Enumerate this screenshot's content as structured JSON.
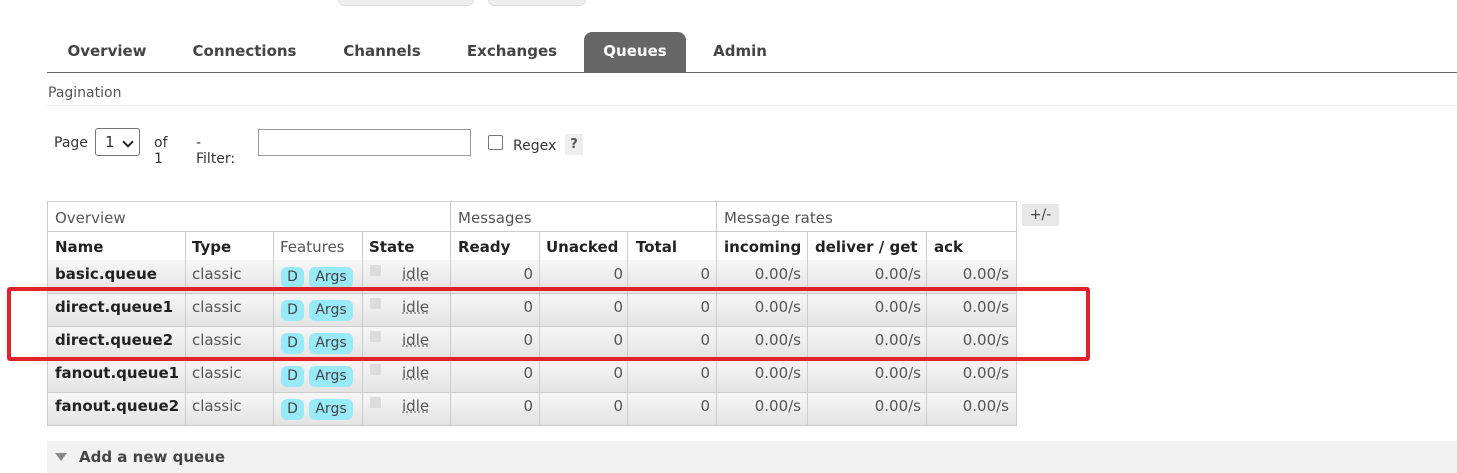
{
  "nav": {
    "tabs": [
      {
        "label": "Overview"
      },
      {
        "label": "Connections"
      },
      {
        "label": "Channels"
      },
      {
        "label": "Exchanges"
      },
      {
        "label": "Queues",
        "active": true
      },
      {
        "label": "Admin"
      }
    ]
  },
  "pagination": {
    "title": "Pagination",
    "page_label": "Page",
    "page_value": "1",
    "of_label": "of 1",
    "filter_label": "- Filter:",
    "filter_value": "",
    "regex_label": "Regex",
    "help_label": "?"
  },
  "table": {
    "groups": [
      "Overview",
      "Messages",
      "Message rates"
    ],
    "columns": [
      "Name",
      "Type",
      "Features",
      "State",
      "Ready",
      "Unacked",
      "Total",
      "incoming",
      "deliver / get",
      "ack"
    ],
    "toggle_label": "+/-",
    "rows": [
      {
        "name": "basic.queue",
        "type": "classic",
        "feature_d": "D",
        "feature_args": "Args",
        "state": "idle",
        "ready": "0",
        "unacked": "0",
        "total": "0",
        "incoming": "0.00/s",
        "deliver_get": "0.00/s",
        "ack": "0.00/s"
      },
      {
        "name": "direct.queue1",
        "type": "classic",
        "feature_d": "D",
        "feature_args": "Args",
        "state": "idle",
        "ready": "0",
        "unacked": "0",
        "total": "0",
        "incoming": "0.00/s",
        "deliver_get": "0.00/s",
        "ack": "0.00/s"
      },
      {
        "name": "direct.queue2",
        "type": "classic",
        "feature_d": "D",
        "feature_args": "Args",
        "state": "idle",
        "ready": "0",
        "unacked": "0",
        "total": "0",
        "incoming": "0.00/s",
        "deliver_get": "0.00/s",
        "ack": "0.00/s"
      },
      {
        "name": "fanout.queue1",
        "type": "classic",
        "feature_d": "D",
        "feature_args": "Args",
        "state": "idle",
        "ready": "0",
        "unacked": "0",
        "total": "0",
        "incoming": "0.00/s",
        "deliver_get": "0.00/s",
        "ack": "0.00/s"
      },
      {
        "name": "fanout.queue2",
        "type": "classic",
        "feature_d": "D",
        "feature_args": "Args",
        "state": "idle",
        "ready": "0",
        "unacked": "0",
        "total": "0",
        "incoming": "0.00/s",
        "deliver_get": "0.00/s",
        "ack": "0.00/s"
      }
    ]
  },
  "add_queue": {
    "label": "Add a new queue",
    "icon": "triangle-down-icon"
  },
  "colors": {
    "active_tab": "#666666",
    "badge": "#99eaf8",
    "highlight": "#e0232b"
  }
}
